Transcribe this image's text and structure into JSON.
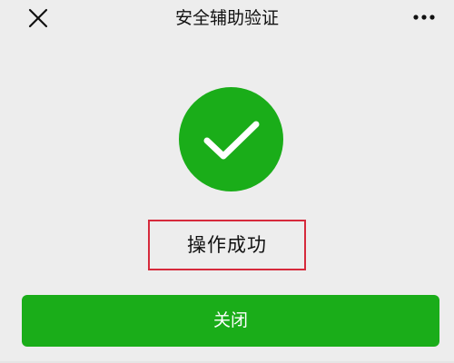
{
  "header": {
    "title": "安全辅助验证",
    "close_icon": "close-icon",
    "more_icon": "more-icon"
  },
  "main": {
    "status_icon": "checkmark-icon",
    "status_color": "#1aad19",
    "result_text": "操作成功",
    "highlight_color": "#d62a3c",
    "close_button_label": "关闭",
    "button_color": "#1aad19"
  }
}
